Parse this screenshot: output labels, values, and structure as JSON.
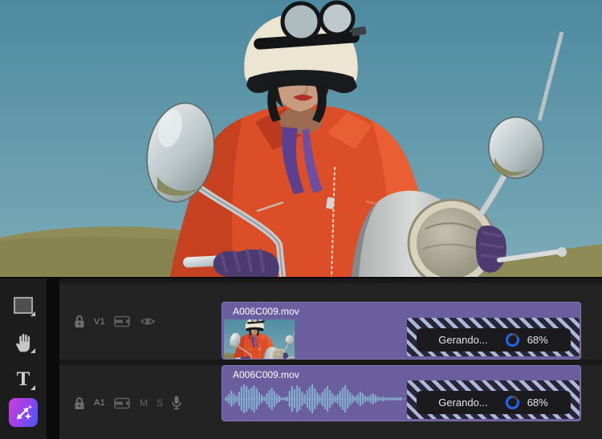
{
  "toolbar": {
    "tools": [
      {
        "id": "selection-tool",
        "icon": "rectangle-icon"
      },
      {
        "id": "hand-tool",
        "icon": "hand-icon"
      },
      {
        "id": "type-tool",
        "icon": "type-icon",
        "glyph": "T"
      },
      {
        "id": "generative-extend-tool",
        "icon": "sparkle-arrows-icon"
      }
    ]
  },
  "timeline": {
    "tracks": [
      {
        "label": "V1",
        "controls": [
          "lock-icon",
          "track-target-icon",
          "eye-icon"
        ]
      },
      {
        "label": "A1",
        "mute_label": "M",
        "solo_label": "S",
        "controls": [
          "lock-icon",
          "track-target-icon",
          "mic-icon"
        ]
      }
    ],
    "clips": [
      {
        "name": "A006C009.mov",
        "track": "V1",
        "kind": "video",
        "progress": {
          "label": "Gerando...",
          "percent_text": "68%",
          "value": 68
        }
      },
      {
        "name": "A006C009.mov",
        "track": "A1",
        "kind": "audio",
        "progress": {
          "label": "Gerando...",
          "percent_text": "68%",
          "value": 68
        }
      }
    ]
  },
  "colors": {
    "clip_purple": "#6a5e9f",
    "stripe_light": "#abb8da",
    "spinner_blue": "#2563e8",
    "ai_gradient_start": "#cb3fd8",
    "ai_gradient_end": "#4558f5",
    "waveform_blue": "#84aecd"
  }
}
